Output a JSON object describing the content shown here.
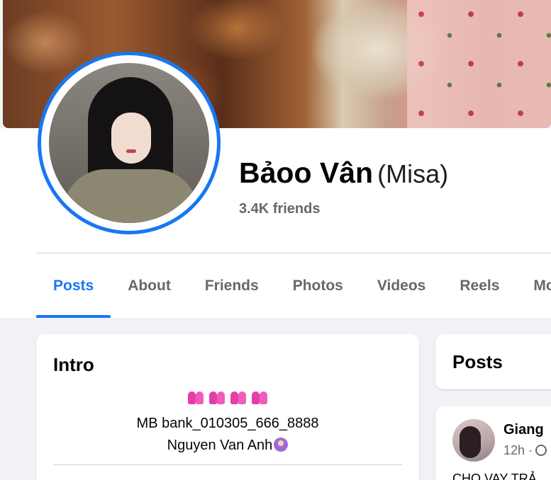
{
  "profile": {
    "name": "Bảoo Vân",
    "alt_name": "(Misa)",
    "friends": "3.4K friends"
  },
  "tabs": [
    {
      "label": "Posts",
      "active": true
    },
    {
      "label": "About"
    },
    {
      "label": "Friends"
    },
    {
      "label": "Photos"
    },
    {
      "label": "Videos"
    },
    {
      "label": "Reels"
    },
    {
      "label": "Mo"
    }
  ],
  "intro": {
    "title": "Intro",
    "bio_line1": "MB bank_010305_666_8888",
    "bio_line2": "Nguyen Van Anh"
  },
  "posts_section": {
    "title": "Posts"
  },
  "post": {
    "author": "Giang",
    "time": "12h ·",
    "text": "CHO VAY TRẢ"
  },
  "colors": {
    "accent": "#1877f2",
    "background": "#f0f2f5",
    "secondary_text": "#65676b"
  }
}
